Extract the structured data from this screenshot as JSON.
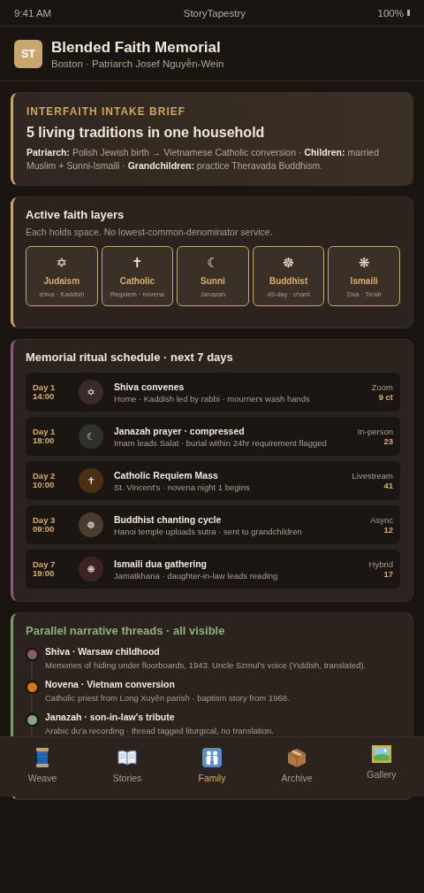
{
  "status_bar": {
    "time": "9:41 AM",
    "app": "StoryTapestry",
    "battery": "100%"
  },
  "header": {
    "logo": "ST",
    "title": "Blended Faith Memorial",
    "subtitle": "Boston · Patriarch Josef Nguyễn-Wein"
  },
  "brief": {
    "eyebrow": "INTERFAITH INTAKE BRIEF",
    "title": "5 living traditions in one household",
    "body": "**Patriarch:** Polish Jewish birth → Vietnamese Catholic conversion · **Children:** married Muslim + Sunni-Ismaili · **Grandchildren:** practice Theravada Buddhism."
  },
  "faith_layers": {
    "title": "Active faith layers",
    "subtitle": "Each holds space. No lowest-common-denominator service.",
    "items": [
      {
        "symbol": "✡",
        "name": "Judaism",
        "detail": "shiva · Kaddish"
      },
      {
        "symbol": "✝",
        "name": "Catholic",
        "detail": "Requiem · novena"
      },
      {
        "symbol": "☾",
        "name": "Sunni",
        "detail": "Janazah"
      },
      {
        "symbol": "☸",
        "name": "Buddhist",
        "detail": "49-day · chant"
      },
      {
        "symbol": "❋",
        "name": "Ismaili",
        "detail": "Dua · Ta'wil"
      }
    ]
  },
  "schedule": {
    "title": "Memorial ritual schedule · next 7 days",
    "items": [
      {
        "day": "Day 1",
        "time": "14:00",
        "symbol": "✡",
        "color": "#3a2a2c",
        "title": "Shiva convenes",
        "detail": "Home · Kaddish led by rabbi · mourners wash hands",
        "mode": "Zoom",
        "count": "9 ct"
      },
      {
        "day": "Day 1",
        "time": "18:00",
        "symbol": "☾",
        "color": "#2f312b",
        "title": "Janazah prayer · compressed",
        "detail": "Imam leads Salat · burial within 24hr requirement flagged",
        "mode": "In-person",
        "count": "23"
      },
      {
        "day": "Day 2",
        "time": "10:00",
        "symbol": "✝",
        "color": "#4a3012",
        "title": "Catholic Requiem Mass",
        "detail": "St. Vincent's · novena night 1 begins",
        "mode": "Livestream",
        "count": "41"
      },
      {
        "day": "Day 3",
        "time": "09:00",
        "symbol": "☸",
        "color": "#4a3d2d",
        "title": "Buddhist chanting cycle",
        "detail": "Hanoi temple uploads sutra · sent to grandchildren",
        "mode": "Async",
        "count": "12"
      },
      {
        "day": "Day 7",
        "time": "19:00",
        "symbol": "❋",
        "color": "#3e2222",
        "title": "Ismaili dua gathering",
        "detail": "Jamatkhana · daughter-in-law leads reading",
        "mode": "Hybrid",
        "count": "17"
      }
    ]
  },
  "threads": {
    "title": "Parallel narrative threads · all visible",
    "items": [
      {
        "color": "#8a5a70",
        "title": "Shiva · Warsaw childhood",
        "detail": "Memories of hiding under floorboards, 1943. Uncle Szmul's voice (Yiddish, translated)."
      },
      {
        "color": "#d47a0a",
        "title": "Novena · Vietnam conversion",
        "detail": "Catholic priest from Long Xuyên parish · baptism story from 1968."
      },
      {
        "color": "#8aa57a",
        "title": "Janazah · son-in-law's tribute",
        "detail": "Arabic du'a recording · thread tagged liturgical, no translation."
      }
    ]
  },
  "nav": [
    {
      "kind": "spool",
      "label": "Weave",
      "selected": false
    },
    {
      "kind": "book",
      "label": "Stories",
      "selected": false
    },
    {
      "kind": "family",
      "label": "Family",
      "selected": true
    },
    {
      "kind": "box",
      "label": "Archive",
      "selected": false
    },
    {
      "kind": "frame",
      "label": "Gallery",
      "selected": false
    }
  ]
}
